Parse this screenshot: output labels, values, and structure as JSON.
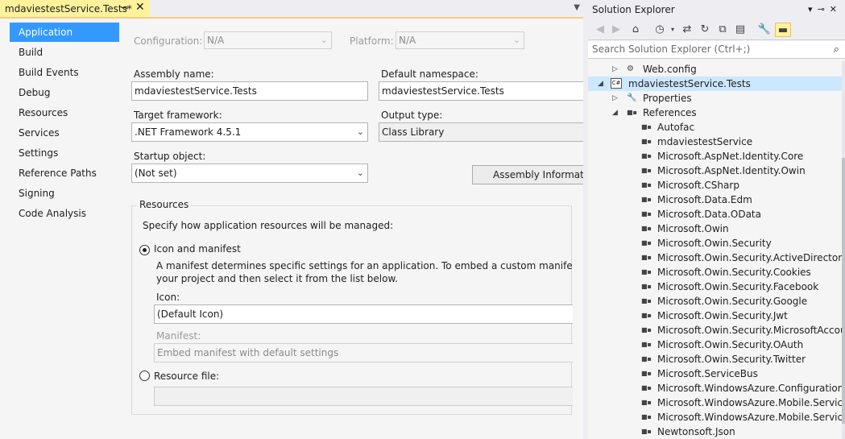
{
  "doc_tab": {
    "title": "mdaviestestService.Tests*",
    "pin": "⊸",
    "close": "✕"
  },
  "nav": [
    "Application",
    "Build",
    "Build Events",
    "Debug",
    "Resources",
    "Services",
    "Settings",
    "Reference Paths",
    "Signing",
    "Code Analysis"
  ],
  "config": {
    "configuration_label": "Configuration:",
    "configuration_value": "N/A",
    "platform_label": "Platform:",
    "platform_value": "N/A"
  },
  "app": {
    "assembly_label": "Assembly name:",
    "assembly_value": "mdaviestestService.Tests",
    "namespace_label": "Default namespace:",
    "namespace_value": "mdaviestestService.Tests",
    "framework_label": "Target framework:",
    "framework_value": ".NET Framework 4.5.1",
    "output_label": "Output type:",
    "output_value": "Class Library",
    "startup_label": "Startup object:",
    "startup_value": "(Not set)",
    "assembly_info_button": "Assembly Information..."
  },
  "resources": {
    "title": "Resources",
    "intro": "Specify how application resources will be managed:",
    "icon_manifest_label": "Icon and manifest",
    "desc_line1": "A manifest determines specific settings for an application. To embed a custom manifest, first add",
    "desc_line2": "your project and then select it from the list below.",
    "icon_label": "Icon:",
    "icon_value": "(Default Icon)",
    "manifest_label": "Manifest:",
    "manifest_value": "Embed manifest with default settings",
    "resource_file_label": "Resource file:",
    "resource_file_value": ""
  },
  "solution_explorer": {
    "title": "Solution Explorer",
    "search_placeholder": "Search Solution Explorer (Ctrl+;)",
    "tree": [
      {
        "label": "Web.config",
        "depth": 1,
        "expander": "▷",
        "icon": "config"
      },
      {
        "label": "mdaviestestService.Tests",
        "depth": 0,
        "expander": "◢",
        "icon": "csproj",
        "selected": true
      },
      {
        "label": "Properties",
        "depth": 1,
        "expander": "▷",
        "icon": "wrench"
      },
      {
        "label": "References",
        "depth": 1,
        "expander": "◢",
        "icon": "ref"
      },
      {
        "label": "Autofac",
        "depth": 2,
        "icon": "ref"
      },
      {
        "label": "mdaviestestService",
        "depth": 2,
        "icon": "ref"
      },
      {
        "label": "Microsoft.AspNet.Identity.Core",
        "depth": 2,
        "icon": "ref"
      },
      {
        "label": "Microsoft.AspNet.Identity.Owin",
        "depth": 2,
        "icon": "ref"
      },
      {
        "label": "Microsoft.CSharp",
        "depth": 2,
        "icon": "ref"
      },
      {
        "label": "Microsoft.Data.Edm",
        "depth": 2,
        "icon": "ref"
      },
      {
        "label": "Microsoft.Data.OData",
        "depth": 2,
        "icon": "ref"
      },
      {
        "label": "Microsoft.Owin",
        "depth": 2,
        "icon": "ref"
      },
      {
        "label": "Microsoft.Owin.Security",
        "depth": 2,
        "icon": "ref"
      },
      {
        "label": "Microsoft.Owin.Security.ActiveDirectory",
        "depth": 2,
        "icon": "ref"
      },
      {
        "label": "Microsoft.Owin.Security.Cookies",
        "depth": 2,
        "icon": "ref"
      },
      {
        "label": "Microsoft.Owin.Security.Facebook",
        "depth": 2,
        "icon": "ref"
      },
      {
        "label": "Microsoft.Owin.Security.Google",
        "depth": 2,
        "icon": "ref"
      },
      {
        "label": "Microsoft.Owin.Security.Jwt",
        "depth": 2,
        "icon": "ref"
      },
      {
        "label": "Microsoft.Owin.Security.MicrosoftAccount",
        "depth": 2,
        "icon": "ref"
      },
      {
        "label": "Microsoft.Owin.Security.OAuth",
        "depth": 2,
        "icon": "ref"
      },
      {
        "label": "Microsoft.Owin.Security.Twitter",
        "depth": 2,
        "icon": "ref"
      },
      {
        "label": "Microsoft.ServiceBus",
        "depth": 2,
        "icon": "ref"
      },
      {
        "label": "Microsoft.WindowsAzure.Configuration",
        "depth": 2,
        "icon": "ref"
      },
      {
        "label": "Microsoft.WindowsAzure.Mobile.Service",
        "depth": 2,
        "icon": "ref"
      },
      {
        "label": "Microsoft.WindowsAzure.Mobile.Service.Tables",
        "depth": 2,
        "icon": "ref"
      },
      {
        "label": "Newtonsoft.Json",
        "depth": 2,
        "icon": "ref"
      }
    ]
  }
}
